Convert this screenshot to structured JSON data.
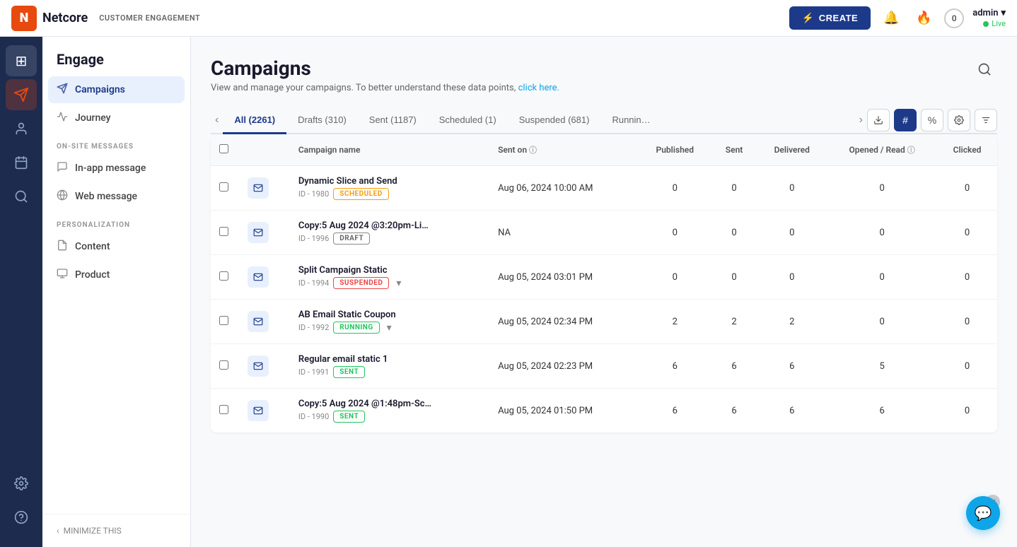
{
  "topnav": {
    "logo_letter": "N",
    "logo_full": "Netcore",
    "product_tag": "CUSTOMER ENGAGEMENT",
    "create_label": "CREATE",
    "bolt_icon": "⚡",
    "notif_icon": "🔔",
    "fire_icon": "🔥",
    "zero_count": "0",
    "admin_name": "admin",
    "chevron_down": "▾",
    "live_label": "Live"
  },
  "icon_rail": {
    "items": [
      {
        "name": "grid-icon",
        "icon": "⊞",
        "active": false
      },
      {
        "name": "megaphone-icon",
        "icon": "📣",
        "active": true
      },
      {
        "name": "users-icon",
        "icon": "👤",
        "active": false
      },
      {
        "name": "calendar-icon",
        "icon": "📅",
        "active": false
      },
      {
        "name": "search-icon",
        "icon": "🔍",
        "active": false
      }
    ],
    "bottom": [
      {
        "name": "settings-icon",
        "icon": "⚙",
        "active": false
      },
      {
        "name": "support-icon",
        "icon": "🙂",
        "active": false
      }
    ]
  },
  "sidebar": {
    "title": "Engage",
    "nav_items": [
      {
        "label": "Campaigns",
        "icon": "🚀",
        "active": true
      },
      {
        "label": "Journey",
        "icon": "✦",
        "active": false
      }
    ],
    "on_site_section": "ON-SITE MESSAGES",
    "on_site_items": [
      {
        "label": "In-app message",
        "icon": "💬",
        "active": false
      },
      {
        "label": "Web message",
        "icon": "🌐",
        "active": false
      }
    ],
    "personalization_section": "PERSONALIZATION",
    "personalization_items": [
      {
        "label": "Content",
        "icon": "📄",
        "active": false
      },
      {
        "label": "Product",
        "icon": "📦",
        "active": false
      }
    ],
    "minimize_label": "MINIMIZE THIS",
    "minimize_arrow": "‹"
  },
  "page": {
    "title": "Campaigns",
    "subtitle": "View and manage your campaigns. To better understand these data points,",
    "subtitle_link": "click here.",
    "search_tooltip": "Search"
  },
  "tabs": {
    "items": [
      {
        "label": "All (2261)",
        "active": true
      },
      {
        "label": "Drafts (310)",
        "active": false
      },
      {
        "label": "Sent (1187)",
        "active": false
      },
      {
        "label": "Scheduled (1)",
        "active": false
      },
      {
        "label": "Suspended (681)",
        "active": false
      },
      {
        "label": "Runnin…",
        "active": false
      }
    ],
    "nav_left": "‹",
    "nav_right": "›",
    "download_icon": "⬇",
    "hash_icon": "#",
    "percent_icon": "%",
    "filter_icon": "≡",
    "settings_icon": "⚙"
  },
  "table": {
    "columns": [
      {
        "label": "",
        "key": "check"
      },
      {
        "label": "",
        "key": "icon"
      },
      {
        "label": "Campaign name",
        "key": "name"
      },
      {
        "label": "Sent on",
        "key": "sent_on",
        "has_info": true
      },
      {
        "label": "Published",
        "key": "published"
      },
      {
        "label": "Sent",
        "key": "sent"
      },
      {
        "label": "Delivered",
        "key": "delivered"
      },
      {
        "label": "Opened / Read",
        "key": "opened_read",
        "has_info": true
      },
      {
        "label": "Clicked",
        "key": "clicked"
      }
    ],
    "rows": [
      {
        "id": 1,
        "name": "Dynamic Slice and Send",
        "campaign_id": "ID - 1980",
        "status": "SCHEDULED",
        "status_class": "status-scheduled",
        "sent_on": "Aug 06, 2024 10:00 AM",
        "published": "0",
        "sent": "0",
        "delivered": "0",
        "opened_read": "0",
        "clicked": "0",
        "has_expand": false
      },
      {
        "id": 2,
        "name": "Copy:5 Aug 2024 @3:20pm-Li…",
        "campaign_id": "ID - 1996",
        "status": "DRAFT",
        "status_class": "status-draft",
        "sent_on": "NA",
        "published": "0",
        "sent": "0",
        "delivered": "0",
        "opened_read": "0",
        "clicked": "0",
        "has_expand": false
      },
      {
        "id": 3,
        "name": "Split Campaign Static",
        "campaign_id": "ID - 1994",
        "status": "SUSPENDED",
        "status_class": "status-suspended",
        "sent_on": "Aug 05, 2024 03:01 PM",
        "published": "0",
        "sent": "0",
        "delivered": "0",
        "opened_read": "0",
        "clicked": "0",
        "has_expand": true
      },
      {
        "id": 4,
        "name": "AB Email Static Coupon",
        "campaign_id": "ID - 1992",
        "status": "RUNNING",
        "status_class": "status-running",
        "sent_on": "Aug 05, 2024 02:34 PM",
        "published": "2",
        "sent": "2",
        "delivered": "2",
        "opened_read": "0",
        "clicked": "0",
        "has_expand": true
      },
      {
        "id": 5,
        "name": "Regular email static 1",
        "campaign_id": "ID - 1991",
        "status": "SENT",
        "status_class": "status-sent",
        "sent_on": "Aug 05, 2024 02:23 PM",
        "published": "6",
        "sent": "6",
        "delivered": "6",
        "opened_read": "5",
        "clicked": "0",
        "has_expand": false
      },
      {
        "id": 6,
        "name": "Copy:5 Aug 2024 @1:48pm-Sc…",
        "campaign_id": "ID - 1990",
        "status": "SENT",
        "status_class": "status-sent",
        "sent_on": "Aug 05, 2024 01:50 PM",
        "published": "6",
        "sent": "6",
        "delivered": "6",
        "opened_read": "6",
        "clicked": "0",
        "has_expand": false
      }
    ]
  }
}
